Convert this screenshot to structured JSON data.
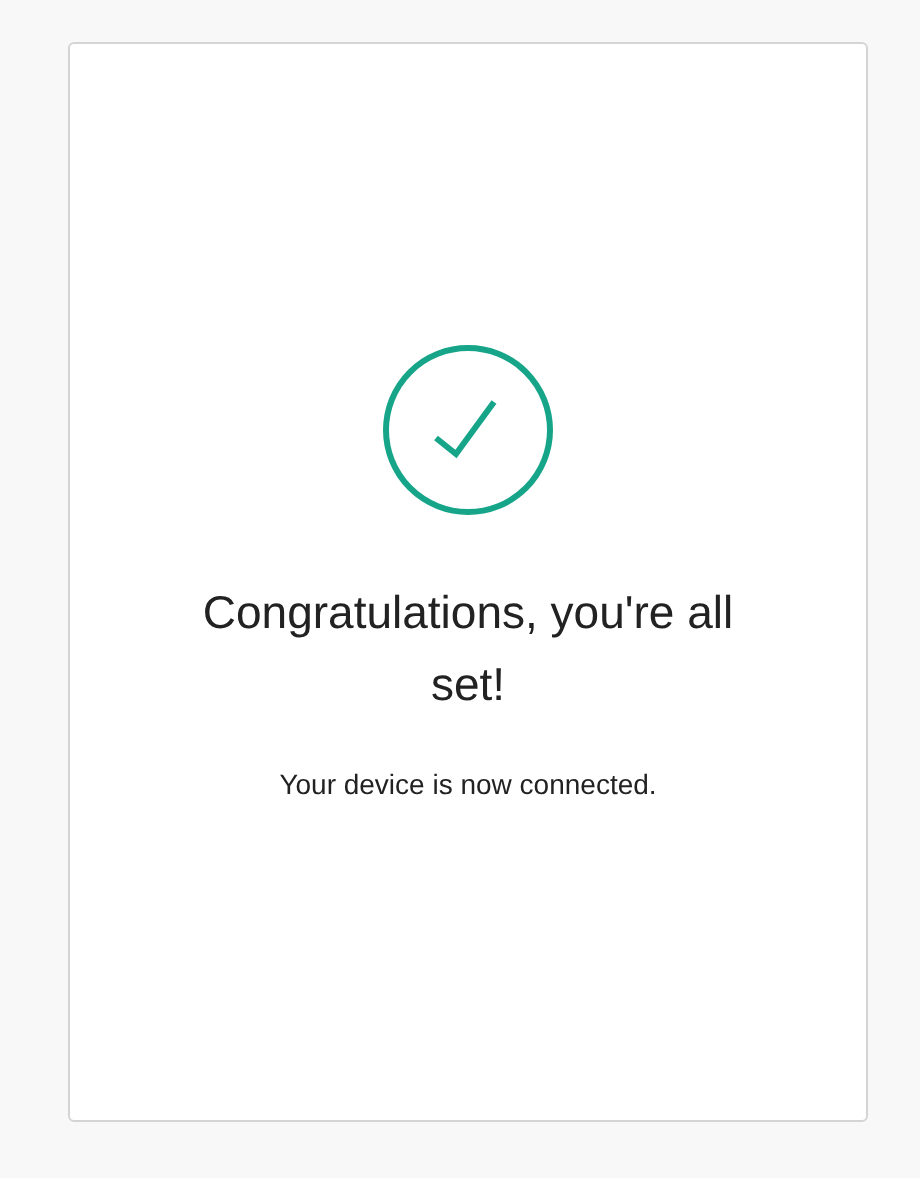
{
  "title": "Congratulations, you're all set!",
  "message": "Your device is now connected."
}
